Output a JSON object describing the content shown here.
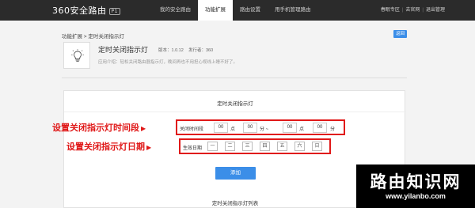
{
  "header": {
    "logo_text": "360安全路由",
    "logo_badge": "P1",
    "nav": [
      {
        "label": "我的安全路由"
      },
      {
        "label": "功能扩展"
      },
      {
        "label": "路由设置"
      },
      {
        "label": "用手机管理路由"
      }
    ],
    "links": [
      {
        "label": "春眠专区"
      },
      {
        "label": "去官网"
      },
      {
        "label": "退出管理"
      }
    ]
  },
  "breadcrumb": "功能扩展 > 定时关闭指示灯",
  "back_label": "返回",
  "app": {
    "title": "定时关闭指示灯",
    "version": "版本：1.0.12",
    "publisher": "发行者：360",
    "description": "应用介绍：轻松关闭路由器指示灯，晚间再也不用担心视线上睡不好了。"
  },
  "panel": {
    "title": "定时关闭指示灯",
    "time_label": "关闭时间段",
    "start_hour": "00",
    "start_hour_unit": "点",
    "start_min": "00",
    "start_min_unit": "分 ~",
    "end_hour": "00",
    "end_hour_unit": "点",
    "end_min": "00",
    "end_min_unit": "分",
    "day_label": "生效日期",
    "days": [
      "一",
      "二",
      "三",
      "四",
      "五",
      "六",
      "日"
    ],
    "add_label": "添加",
    "list_title": "定时关闭指示灯列表"
  },
  "annotations": {
    "time": "设置关闭指示灯时间段",
    "date": "设置关闭指示灯日期",
    "arrow": "▶"
  },
  "watermark": {
    "title": "路由知识网",
    "url": "www.yilanbo.com"
  },
  "colors": {
    "header_bg": "#2b2b2b",
    "accent_blue": "#3b8ee8",
    "annotation_red": "#e01818"
  }
}
